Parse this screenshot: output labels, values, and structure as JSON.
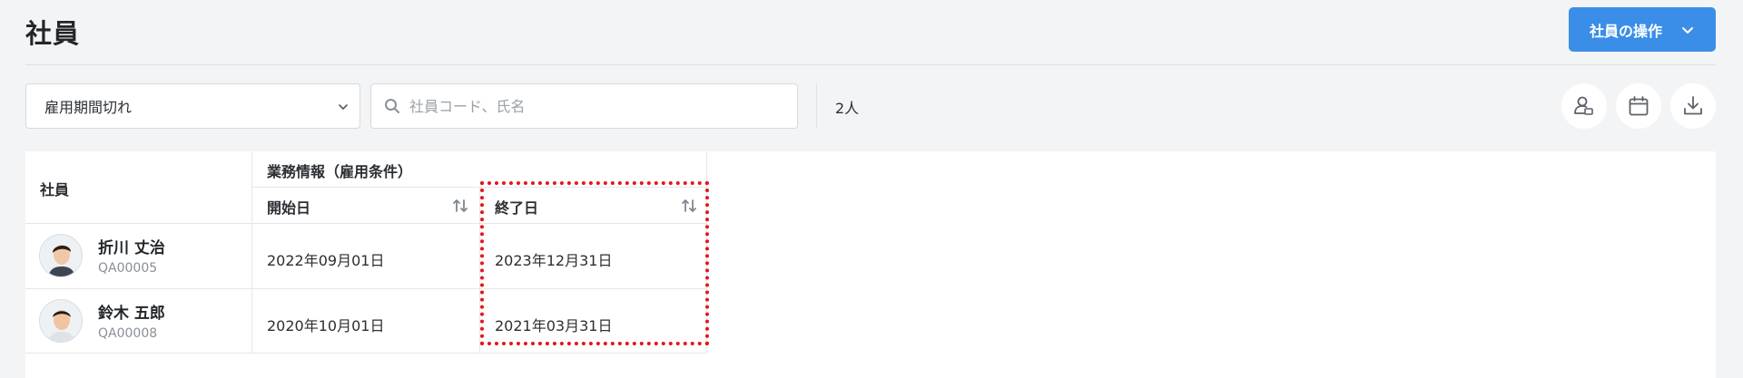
{
  "header": {
    "title": "社員",
    "ops_button_label": "社員の操作"
  },
  "toolbar": {
    "filter_select_value": "雇用期間切れ",
    "search_placeholder": "社員コード、氏名",
    "count_label": "2人"
  },
  "table": {
    "col_employee": "社員",
    "group_header": "業務情報（雇用条件）",
    "col_start": "開始日",
    "col_end": "終了日",
    "rows": [
      {
        "name": "折川 丈治",
        "code": "QA00005",
        "start": "2022年09月01日",
        "end": "2023年12月31日"
      },
      {
        "name": "鈴木 五郎",
        "code": "QA00008",
        "start": "2020年10月01日",
        "end": "2021年03月31日"
      }
    ]
  },
  "colors": {
    "accent": "#3b8ee8",
    "highlight": "#e3161b"
  },
  "icons": [
    "chevron-down-icon",
    "search-icon",
    "person-badge-icon",
    "calendar-icon",
    "download-icon",
    "sort-icon"
  ]
}
